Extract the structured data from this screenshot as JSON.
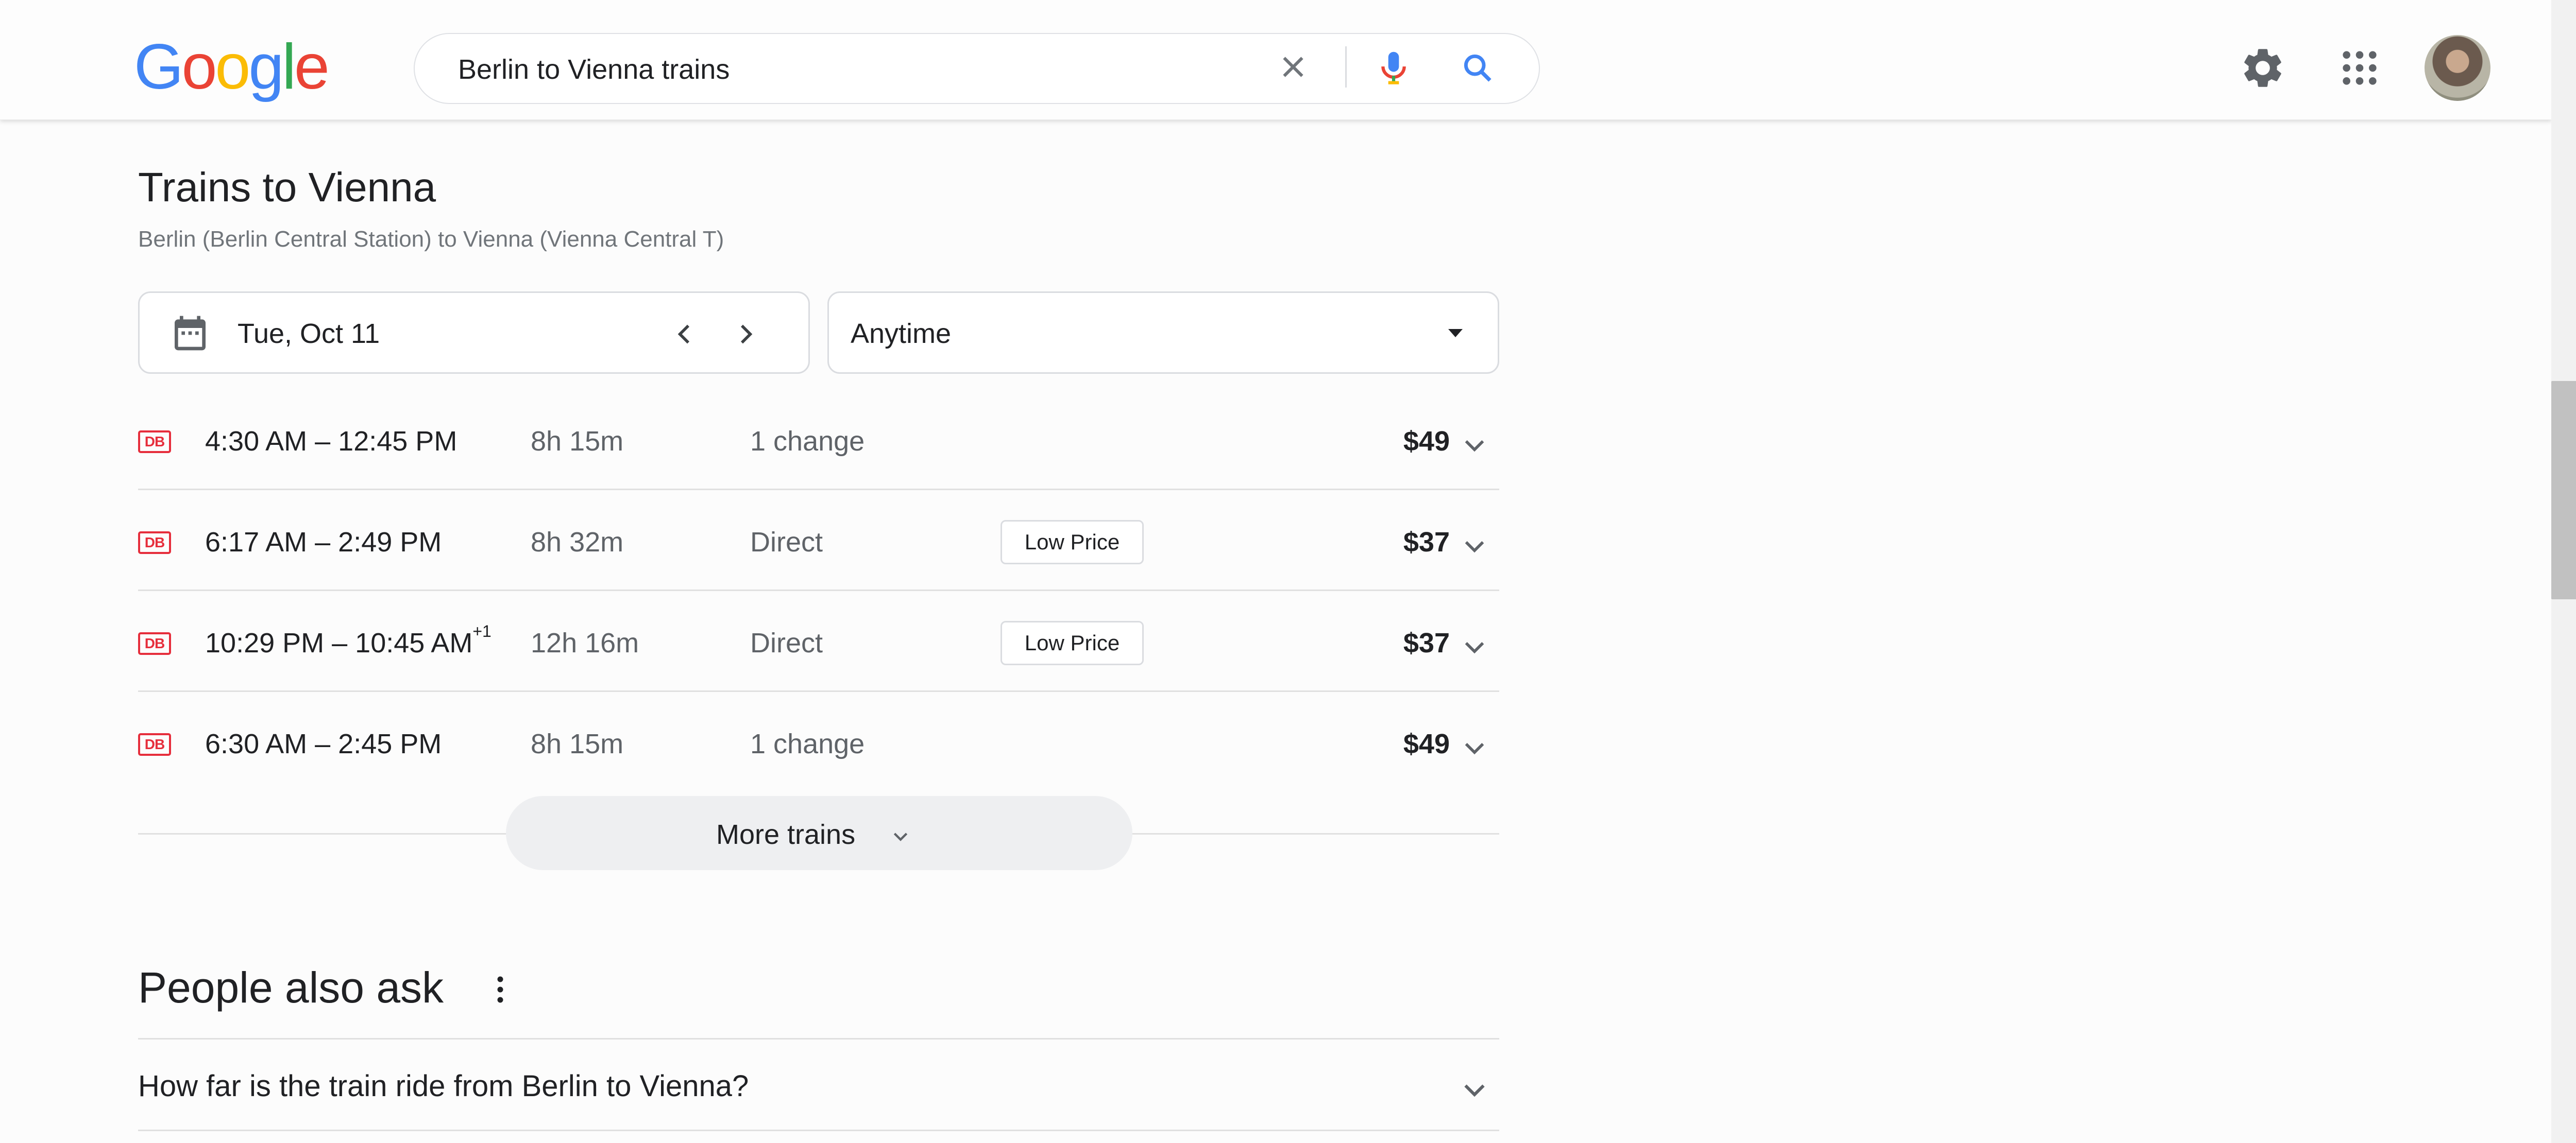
{
  "header": {
    "logo_letters": [
      "G",
      "o",
      "o",
      "g",
      "l",
      "e"
    ],
    "search_query": "Berlin to Vienna trains",
    "icons": [
      "clear-icon",
      "mic-icon",
      "search-icon",
      "settings-icon",
      "apps-icon"
    ]
  },
  "trains": {
    "title": "Trains to Vienna",
    "subtitle": "Berlin (Berlin Central Station) to Vienna (Vienna Central T)",
    "date": "Tue, Oct 11",
    "time_filter": "Anytime",
    "operator_logo_text": "DB",
    "rows": [
      {
        "times": "4:30 AM – 12:45 PM",
        "next_day": "",
        "duration": "8h 15m",
        "changes": "1 change",
        "badge": "",
        "price": "$49"
      },
      {
        "times": "6:17 AM – 2:49 PM",
        "next_day": "",
        "duration": "8h 32m",
        "changes": "Direct",
        "badge": "Low Price",
        "price": "$37"
      },
      {
        "times": "10:29 PM – 10:45 AM",
        "next_day": "+1",
        "duration": "12h 16m",
        "changes": "Direct",
        "badge": "Low Price",
        "price": "$37"
      },
      {
        "times": "6:30 AM – 2:45 PM",
        "next_day": "",
        "duration": "8h 15m",
        "changes": "1 change",
        "badge": "",
        "price": "$49"
      }
    ],
    "more_label": "More trains"
  },
  "people_also_ask": {
    "title": "People also ask",
    "questions": [
      "How far is the train ride from Berlin to Vienna?"
    ]
  },
  "colors": {
    "db_red": "#e62e3c",
    "google_blue": "#4285f4",
    "google_red": "#ea4335",
    "google_yellow": "#fbbc05",
    "google_green": "#34a853"
  }
}
